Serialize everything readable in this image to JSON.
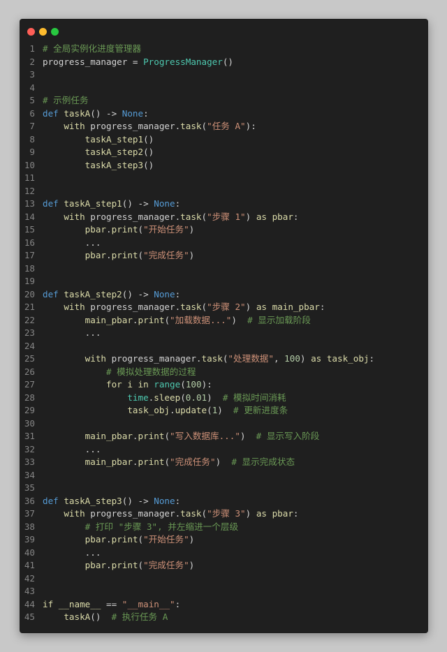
{
  "window": {
    "traffic_lights": [
      {
        "name": "close",
        "color": "#ff5f57"
      },
      {
        "name": "minimize",
        "color": "#febc2e"
      },
      {
        "name": "zoom",
        "color": "#28c840"
      }
    ]
  },
  "colors": {
    "background": "#c8c8c8",
    "editor_bg": "#1f1f1f",
    "line_number": "#858585",
    "keyword": "#c586c0",
    "function": "#dcdcaa",
    "class": "#4ec9b0",
    "string": "#ce9178",
    "number": "#b5cea8",
    "comment": "#6a9955"
  },
  "code_lines": [
    {
      "n": "1",
      "tokens": [
        {
          "t": "# 全局实例化进度管理器",
          "c": "cmt"
        }
      ]
    },
    {
      "n": "2",
      "tokens": [
        {
          "t": "progress_manager",
          "c": "plain"
        },
        {
          "t": " = ",
          "c": "plain"
        },
        {
          "t": "ProgressManager",
          "c": "cls"
        },
        {
          "t": "()",
          "c": "plain"
        }
      ]
    },
    {
      "n": "3",
      "tokens": []
    },
    {
      "n": "4",
      "tokens": []
    },
    {
      "n": "5",
      "tokens": [
        {
          "t": "# 示例任务",
          "c": "cmt"
        }
      ]
    },
    {
      "n": "6",
      "tokens": [
        {
          "t": "def",
          "c": "kwb"
        },
        {
          "t": " ",
          "c": "plain"
        },
        {
          "t": "taskA",
          "c": "fn"
        },
        {
          "t": "() -> ",
          "c": "plain"
        },
        {
          "t": "None",
          "c": "kwb"
        },
        {
          "t": ":",
          "c": "plain"
        }
      ]
    },
    {
      "n": "7",
      "tokens": [
        {
          "t": "    ",
          "c": "plain"
        },
        {
          "t": "with",
          "c": "fn"
        },
        {
          "t": " progress_manager.",
          "c": "plain"
        },
        {
          "t": "task",
          "c": "fn"
        },
        {
          "t": "(",
          "c": "plain"
        },
        {
          "t": "\"任务 A\"",
          "c": "str"
        },
        {
          "t": "):",
          "c": "plain"
        }
      ]
    },
    {
      "n": "8",
      "tokens": [
        {
          "t": "        ",
          "c": "plain"
        },
        {
          "t": "taskA_step1",
          "c": "fn"
        },
        {
          "t": "()",
          "c": "plain"
        }
      ]
    },
    {
      "n": "9",
      "tokens": [
        {
          "t": "        ",
          "c": "plain"
        },
        {
          "t": "taskA_step2",
          "c": "fn"
        },
        {
          "t": "()",
          "c": "plain"
        }
      ]
    },
    {
      "n": "10",
      "tokens": [
        {
          "t": "        ",
          "c": "plain"
        },
        {
          "t": "taskA_step3",
          "c": "fn"
        },
        {
          "t": "()",
          "c": "plain"
        }
      ]
    },
    {
      "n": "11",
      "tokens": []
    },
    {
      "n": "12",
      "tokens": []
    },
    {
      "n": "13",
      "tokens": [
        {
          "t": "def",
          "c": "kwb"
        },
        {
          "t": " ",
          "c": "plain"
        },
        {
          "t": "taskA_step1",
          "c": "fn"
        },
        {
          "t": "() -> ",
          "c": "plain"
        },
        {
          "t": "None",
          "c": "kwb"
        },
        {
          "t": ":",
          "c": "plain"
        }
      ]
    },
    {
      "n": "14",
      "tokens": [
        {
          "t": "    ",
          "c": "plain"
        },
        {
          "t": "with",
          "c": "fn"
        },
        {
          "t": " progress_manager.",
          "c": "plain"
        },
        {
          "t": "task",
          "c": "fn"
        },
        {
          "t": "(",
          "c": "plain"
        },
        {
          "t": "\"步骤 1\"",
          "c": "str"
        },
        {
          "t": ") ",
          "c": "plain"
        },
        {
          "t": "as",
          "c": "fn"
        },
        {
          "t": " ",
          "c": "plain"
        },
        {
          "t": "pbar",
          "c": "fn"
        },
        {
          "t": ":",
          "c": "plain"
        }
      ]
    },
    {
      "n": "15",
      "tokens": [
        {
          "t": "        ",
          "c": "plain"
        },
        {
          "t": "pbar",
          "c": "fn"
        },
        {
          "t": ".",
          "c": "plain"
        },
        {
          "t": "print",
          "c": "fn"
        },
        {
          "t": "(",
          "c": "plain"
        },
        {
          "t": "\"开始任务\"",
          "c": "str"
        },
        {
          "t": ")",
          "c": "plain"
        }
      ]
    },
    {
      "n": "16",
      "tokens": [
        {
          "t": "        ...",
          "c": "plain"
        }
      ]
    },
    {
      "n": "17",
      "tokens": [
        {
          "t": "        ",
          "c": "plain"
        },
        {
          "t": "pbar",
          "c": "fn"
        },
        {
          "t": ".",
          "c": "plain"
        },
        {
          "t": "print",
          "c": "fn"
        },
        {
          "t": "(",
          "c": "plain"
        },
        {
          "t": "\"完成任务\"",
          "c": "str"
        },
        {
          "t": ")",
          "c": "plain"
        }
      ]
    },
    {
      "n": "18",
      "tokens": []
    },
    {
      "n": "19",
      "tokens": []
    },
    {
      "n": "20",
      "tokens": [
        {
          "t": "def",
          "c": "kwb"
        },
        {
          "t": " ",
          "c": "plain"
        },
        {
          "t": "taskA_step2",
          "c": "fn"
        },
        {
          "t": "() -> ",
          "c": "plain"
        },
        {
          "t": "None",
          "c": "kwb"
        },
        {
          "t": ":",
          "c": "plain"
        }
      ]
    },
    {
      "n": "21",
      "tokens": [
        {
          "t": "    ",
          "c": "plain"
        },
        {
          "t": "with",
          "c": "fn"
        },
        {
          "t": " progress_manager.",
          "c": "plain"
        },
        {
          "t": "task",
          "c": "fn"
        },
        {
          "t": "(",
          "c": "plain"
        },
        {
          "t": "\"步骤 2\"",
          "c": "str"
        },
        {
          "t": ") ",
          "c": "plain"
        },
        {
          "t": "as",
          "c": "fn"
        },
        {
          "t": " ",
          "c": "plain"
        },
        {
          "t": "main_pbar",
          "c": "fn"
        },
        {
          "t": ":",
          "c": "plain"
        }
      ]
    },
    {
      "n": "22",
      "tokens": [
        {
          "t": "        ",
          "c": "plain"
        },
        {
          "t": "main_pbar",
          "c": "fn"
        },
        {
          "t": ".",
          "c": "plain"
        },
        {
          "t": "print",
          "c": "fn"
        },
        {
          "t": "(",
          "c": "plain"
        },
        {
          "t": "\"加载数据...\"",
          "c": "str"
        },
        {
          "t": ")  ",
          "c": "plain"
        },
        {
          "t": "# 显示加载阶段",
          "c": "cmt"
        }
      ]
    },
    {
      "n": "23",
      "tokens": [
        {
          "t": "        ...",
          "c": "plain"
        }
      ]
    },
    {
      "n": "24",
      "tokens": []
    },
    {
      "n": "25",
      "tokens": [
        {
          "t": "        ",
          "c": "plain"
        },
        {
          "t": "with",
          "c": "fn"
        },
        {
          "t": " progress_manager.",
          "c": "plain"
        },
        {
          "t": "task",
          "c": "fn"
        },
        {
          "t": "(",
          "c": "plain"
        },
        {
          "t": "\"处理数据\"",
          "c": "str"
        },
        {
          "t": ", ",
          "c": "plain"
        },
        {
          "t": "100",
          "c": "num"
        },
        {
          "t": ") ",
          "c": "plain"
        },
        {
          "t": "as",
          "c": "fn"
        },
        {
          "t": " ",
          "c": "plain"
        },
        {
          "t": "task_obj",
          "c": "fn"
        },
        {
          "t": ":",
          "c": "plain"
        }
      ]
    },
    {
      "n": "26",
      "tokens": [
        {
          "t": "            ",
          "c": "plain"
        },
        {
          "t": "# 模拟处理数据的过程",
          "c": "cmt"
        }
      ]
    },
    {
      "n": "27",
      "tokens": [
        {
          "t": "            ",
          "c": "plain"
        },
        {
          "t": "for",
          "c": "fn"
        },
        {
          "t": " ",
          "c": "plain"
        },
        {
          "t": "i",
          "c": "fn"
        },
        {
          "t": " ",
          "c": "plain"
        },
        {
          "t": "in",
          "c": "fn"
        },
        {
          "t": " ",
          "c": "plain"
        },
        {
          "t": "range",
          "c": "cls"
        },
        {
          "t": "(",
          "c": "plain"
        },
        {
          "t": "100",
          "c": "num"
        },
        {
          "t": "):",
          "c": "plain"
        }
      ]
    },
    {
      "n": "28",
      "tokens": [
        {
          "t": "                ",
          "c": "plain"
        },
        {
          "t": "time",
          "c": "cls"
        },
        {
          "t": ".",
          "c": "plain"
        },
        {
          "t": "sleep",
          "c": "fn"
        },
        {
          "t": "(",
          "c": "plain"
        },
        {
          "t": "0.01",
          "c": "num"
        },
        {
          "t": ")  ",
          "c": "plain"
        },
        {
          "t": "# 模拟时间消耗",
          "c": "cmt"
        }
      ]
    },
    {
      "n": "29",
      "tokens": [
        {
          "t": "                ",
          "c": "plain"
        },
        {
          "t": "task_obj",
          "c": "fn"
        },
        {
          "t": ".",
          "c": "plain"
        },
        {
          "t": "update",
          "c": "fn"
        },
        {
          "t": "(",
          "c": "plain"
        },
        {
          "t": "1",
          "c": "num"
        },
        {
          "t": ")  ",
          "c": "plain"
        },
        {
          "t": "# 更新进度条",
          "c": "cmt"
        }
      ]
    },
    {
      "n": "30",
      "tokens": []
    },
    {
      "n": "31",
      "tokens": [
        {
          "t": "        ",
          "c": "plain"
        },
        {
          "t": "main_pbar",
          "c": "fn"
        },
        {
          "t": ".",
          "c": "plain"
        },
        {
          "t": "print",
          "c": "fn"
        },
        {
          "t": "(",
          "c": "plain"
        },
        {
          "t": "\"写入数据库...\"",
          "c": "str"
        },
        {
          "t": ")  ",
          "c": "plain"
        },
        {
          "t": "# 显示写入阶段",
          "c": "cmt"
        }
      ]
    },
    {
      "n": "32",
      "tokens": [
        {
          "t": "        ...",
          "c": "plain"
        }
      ]
    },
    {
      "n": "33",
      "tokens": [
        {
          "t": "        ",
          "c": "plain"
        },
        {
          "t": "main_pbar",
          "c": "fn"
        },
        {
          "t": ".",
          "c": "plain"
        },
        {
          "t": "print",
          "c": "fn"
        },
        {
          "t": "(",
          "c": "plain"
        },
        {
          "t": "\"完成任务\"",
          "c": "str"
        },
        {
          "t": ")  ",
          "c": "plain"
        },
        {
          "t": "# 显示完成状态",
          "c": "cmt"
        }
      ]
    },
    {
      "n": "34",
      "tokens": []
    },
    {
      "n": "35",
      "tokens": []
    },
    {
      "n": "36",
      "tokens": [
        {
          "t": "def",
          "c": "kwb"
        },
        {
          "t": " ",
          "c": "plain"
        },
        {
          "t": "taskA_step3",
          "c": "fn"
        },
        {
          "t": "() -> ",
          "c": "plain"
        },
        {
          "t": "None",
          "c": "kwb"
        },
        {
          "t": ":",
          "c": "plain"
        }
      ]
    },
    {
      "n": "37",
      "tokens": [
        {
          "t": "    ",
          "c": "plain"
        },
        {
          "t": "with",
          "c": "fn"
        },
        {
          "t": " progress_manager.",
          "c": "plain"
        },
        {
          "t": "task",
          "c": "fn"
        },
        {
          "t": "(",
          "c": "plain"
        },
        {
          "t": "\"步骤 3\"",
          "c": "str"
        },
        {
          "t": ") ",
          "c": "plain"
        },
        {
          "t": "as",
          "c": "fn"
        },
        {
          "t": " ",
          "c": "plain"
        },
        {
          "t": "pbar",
          "c": "fn"
        },
        {
          "t": ":",
          "c": "plain"
        }
      ]
    },
    {
      "n": "38",
      "tokens": [
        {
          "t": "        ",
          "c": "plain"
        },
        {
          "t": "# 打印 \"步骤 3\", 并左缩进一个层级",
          "c": "cmt"
        }
      ]
    },
    {
      "n": "39",
      "tokens": [
        {
          "t": "        ",
          "c": "plain"
        },
        {
          "t": "pbar",
          "c": "fn"
        },
        {
          "t": ".",
          "c": "plain"
        },
        {
          "t": "print",
          "c": "fn"
        },
        {
          "t": "(",
          "c": "plain"
        },
        {
          "t": "\"开始任务\"",
          "c": "str"
        },
        {
          "t": ")",
          "c": "plain"
        }
      ]
    },
    {
      "n": "40",
      "tokens": [
        {
          "t": "        ...",
          "c": "plain"
        }
      ]
    },
    {
      "n": "41",
      "tokens": [
        {
          "t": "        ",
          "c": "plain"
        },
        {
          "t": "pbar",
          "c": "fn"
        },
        {
          "t": ".",
          "c": "plain"
        },
        {
          "t": "print",
          "c": "fn"
        },
        {
          "t": "(",
          "c": "plain"
        },
        {
          "t": "\"完成任务\"",
          "c": "str"
        },
        {
          "t": ")",
          "c": "plain"
        }
      ]
    },
    {
      "n": "42",
      "tokens": []
    },
    {
      "n": "43",
      "tokens": []
    },
    {
      "n": "44",
      "tokens": [
        {
          "t": "if",
          "c": "fn"
        },
        {
          "t": " ",
          "c": "plain"
        },
        {
          "t": "__name__",
          "c": "fn"
        },
        {
          "t": " == ",
          "c": "plain"
        },
        {
          "t": "\"__main__\"",
          "c": "str"
        },
        {
          "t": ":",
          "c": "plain"
        }
      ]
    },
    {
      "n": "45",
      "tokens": [
        {
          "t": "    ",
          "c": "plain"
        },
        {
          "t": "taskA",
          "c": "fn"
        },
        {
          "t": "()  ",
          "c": "plain"
        },
        {
          "t": "# 执行任务 A",
          "c": "cmt"
        }
      ]
    }
  ]
}
